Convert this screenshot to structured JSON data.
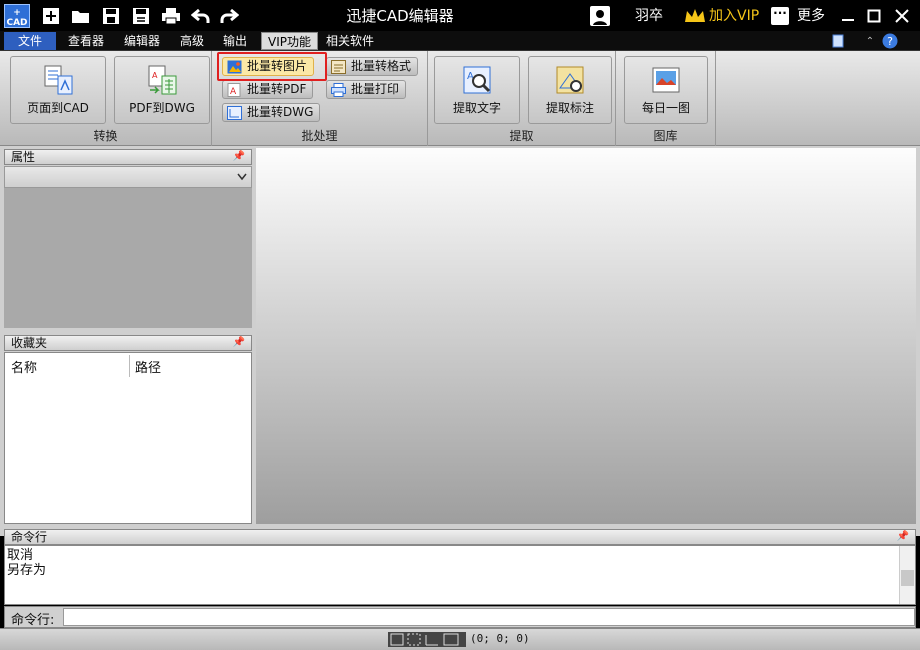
{
  "app": {
    "title": "迅捷CAD编辑器",
    "icon_text": "CAD"
  },
  "quick_access": [
    "new-icon",
    "open-icon",
    "save-icon",
    "save-as-icon",
    "print-icon",
    "undo-icon",
    "redo-icon"
  ],
  "user": {
    "name": "羽卒",
    "vip_label": "加入VIP",
    "more_label": "更多"
  },
  "menu": {
    "file": "文件",
    "items": [
      "查看器",
      "编辑器",
      "高级",
      "输出",
      "VIP功能",
      "相关软件"
    ],
    "active": "VIP功能"
  },
  "ribbon": {
    "convert": {
      "label": "转换",
      "page_to_cad": "页面到CAD",
      "pdf_to_dwg": "PDF到DWG"
    },
    "batch": {
      "label": "批处理",
      "to_image": "批量转图片",
      "to_format": "批量转格式",
      "to_pdf": "批量转PDF",
      "print": "批量打印",
      "to_dwg": "批量转DWG"
    },
    "extract": {
      "label": "提取",
      "text": "提取文字",
      "dims": "提取标注"
    },
    "gallery": {
      "label": "图库",
      "daily": "每日一图"
    }
  },
  "properties": {
    "title": "属性"
  },
  "favorites": {
    "title": "收藏夹",
    "col_name": "名称",
    "col_path": "路径"
  },
  "command": {
    "title": "命令行",
    "history": [
      "取消",
      "另存为"
    ],
    "input_label": "命令行:"
  },
  "status": {
    "coords": "(0; 0; 0)"
  },
  "colors": {
    "accent": "#2e5fbf",
    "vip": "#f5c518",
    "highlight": "#e02020"
  }
}
